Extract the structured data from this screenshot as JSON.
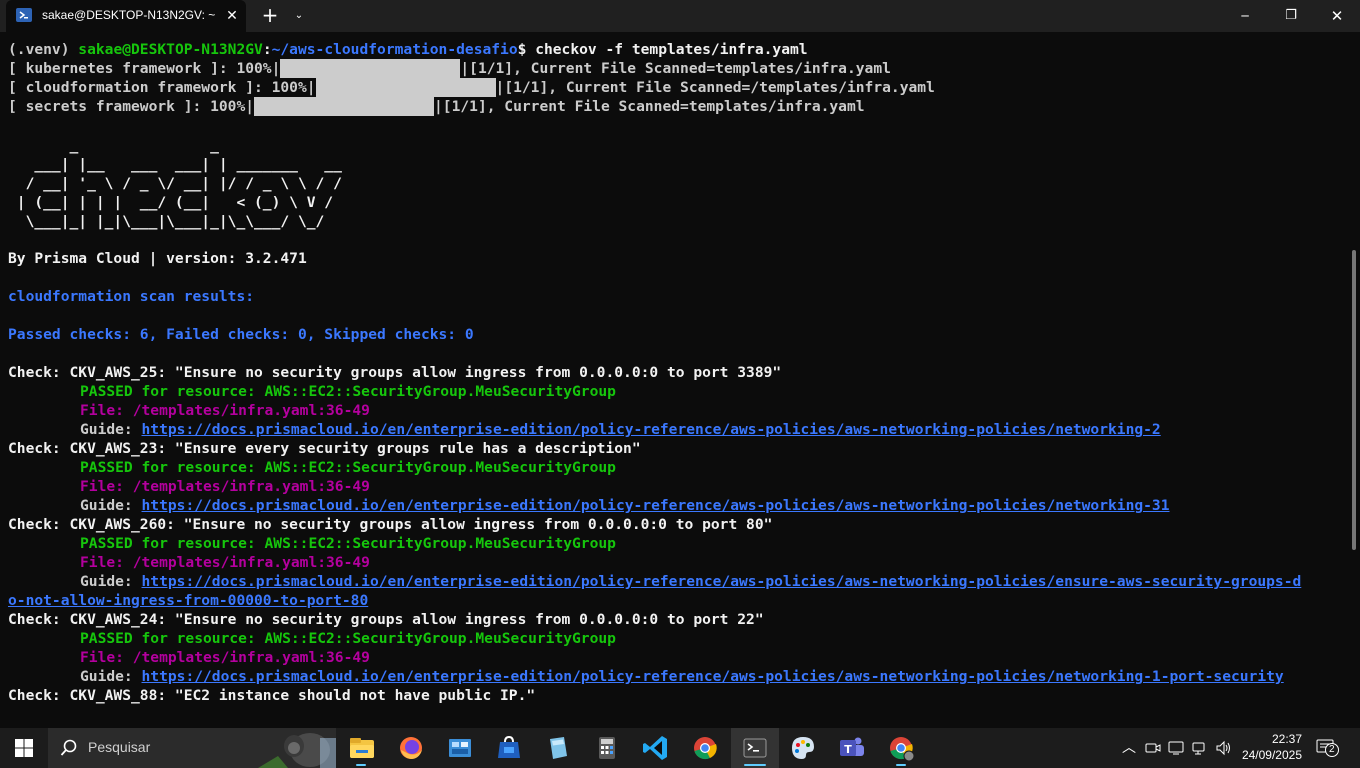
{
  "window": {
    "tab_title": "sakae@DESKTOP-N13N2GV: ~",
    "close_tab": "✕",
    "new_tab": "+",
    "dropdown": "⌄",
    "minimize": "─",
    "maximize": "❐",
    "close": "✕"
  },
  "terminal": {
    "prompt_venv": "(.venv) ",
    "prompt_user": "sakae@DESKTOP-N13N2GV",
    "prompt_colon": ":",
    "prompt_path": "~/aws-cloudformation-desafio",
    "prompt_symbol": "$ ",
    "command": "checkov -f templates/infra.yaml",
    "progress": [
      {
        "prefix": "[ kubernetes framework ]: 100%|",
        "suffix": "|[1/1], Current File Scanned=templates/infra.yaml",
        "percent": 100
      },
      {
        "prefix": "[ cloudformation framework ]: 100%|",
        "suffix": "|[1/1], Current File Scanned=/templates/infra.yaml",
        "percent": 100
      },
      {
        "prefix": "[ secrets framework ]: 100%|",
        "suffix": "|[1/1], Current File Scanned=templates/infra.yaml",
        "percent": 100
      }
    ],
    "ascii_art": "       _               _\n   ___| |__   ___  ___| | _______   __\n  / __| '_ \\ / _ \\/ __| |/ / _ \\ \\ / /\n | (__| | | |  __/ (__|   < (_) \\ V /\n  \\___|_| |_|\\___|\\___|_|\\_\\___/ \\_/",
    "by_line": "By Prisma Cloud | version: 3.2.471",
    "scan_results": "cloudformation scan results:",
    "summary": "Passed checks: 6, Failed checks: 0, Skipped checks: 0",
    "checks": [
      {
        "check": "Check: CKV_AWS_25: \"Ensure no security groups allow ingress from 0.0.0.0:0 to port 3389\"",
        "passed": "PASSED for resource: AWS::EC2::SecurityGroup.MeuSecurityGroup",
        "file": "File: /templates/infra.yaml:36-49",
        "guide_label": "Guide: ",
        "guide_url": "https://docs.prismacloud.io/en/enterprise-edition/policy-reference/aws-policies/aws-networking-policies/networking-2",
        "guide_url_cont": ""
      },
      {
        "check": "Check: CKV_AWS_23: \"Ensure every security groups rule has a description\"",
        "passed": "PASSED for resource: AWS::EC2::SecurityGroup.MeuSecurityGroup",
        "file": "File: /templates/infra.yaml:36-49",
        "guide_label": "Guide: ",
        "guide_url": "https://docs.prismacloud.io/en/enterprise-edition/policy-reference/aws-policies/aws-networking-policies/networking-31",
        "guide_url_cont": ""
      },
      {
        "check": "Check: CKV_AWS_260: \"Ensure no security groups allow ingress from 0.0.0.0:0 to port 80\"",
        "passed": "PASSED for resource: AWS::EC2::SecurityGroup.MeuSecurityGroup",
        "file": "File: /templates/infra.yaml:36-49",
        "guide_label": "Guide: ",
        "guide_url": "https://docs.prismacloud.io/en/enterprise-edition/policy-reference/aws-policies/aws-networking-policies/ensure-aws-security-groups-d",
        "guide_url_cont": "o-not-allow-ingress-from-00000-to-port-80"
      },
      {
        "check": "Check: CKV_AWS_24: \"Ensure no security groups allow ingress from 0.0.0.0:0 to port 22\"",
        "passed": "PASSED for resource: AWS::EC2::SecurityGroup.MeuSecurityGroup",
        "file": "File: /templates/infra.yaml:36-49",
        "guide_label": "Guide: ",
        "guide_url": "https://docs.prismacloud.io/en/enterprise-edition/policy-reference/aws-policies/aws-networking-policies/networking-1-port-security",
        "guide_url_cont": ""
      }
    ],
    "last_check": "Check: CKV_AWS_88: \"EC2 instance should not have public IP.\""
  },
  "taskbar": {
    "search_placeholder": "Pesquisar",
    "time": "22:37",
    "date": "24/09/2025",
    "notification_count": "2",
    "tray_chevron": "︿",
    "icons": [
      "file-explorer-icon",
      "firefox-icon",
      "control-panel-icon",
      "store-icon",
      "notepad-icon",
      "calculator-icon",
      "vscode-icon",
      "chrome-icon",
      "terminal-icon",
      "paint-icon",
      "teams-icon",
      "chrome-profile-icon"
    ]
  },
  "colors": {
    "background": "#0c0c0c",
    "green": "#16c60c",
    "blue": "#3b78ff",
    "purple": "#b4009e",
    "text": "#cccccc"
  }
}
